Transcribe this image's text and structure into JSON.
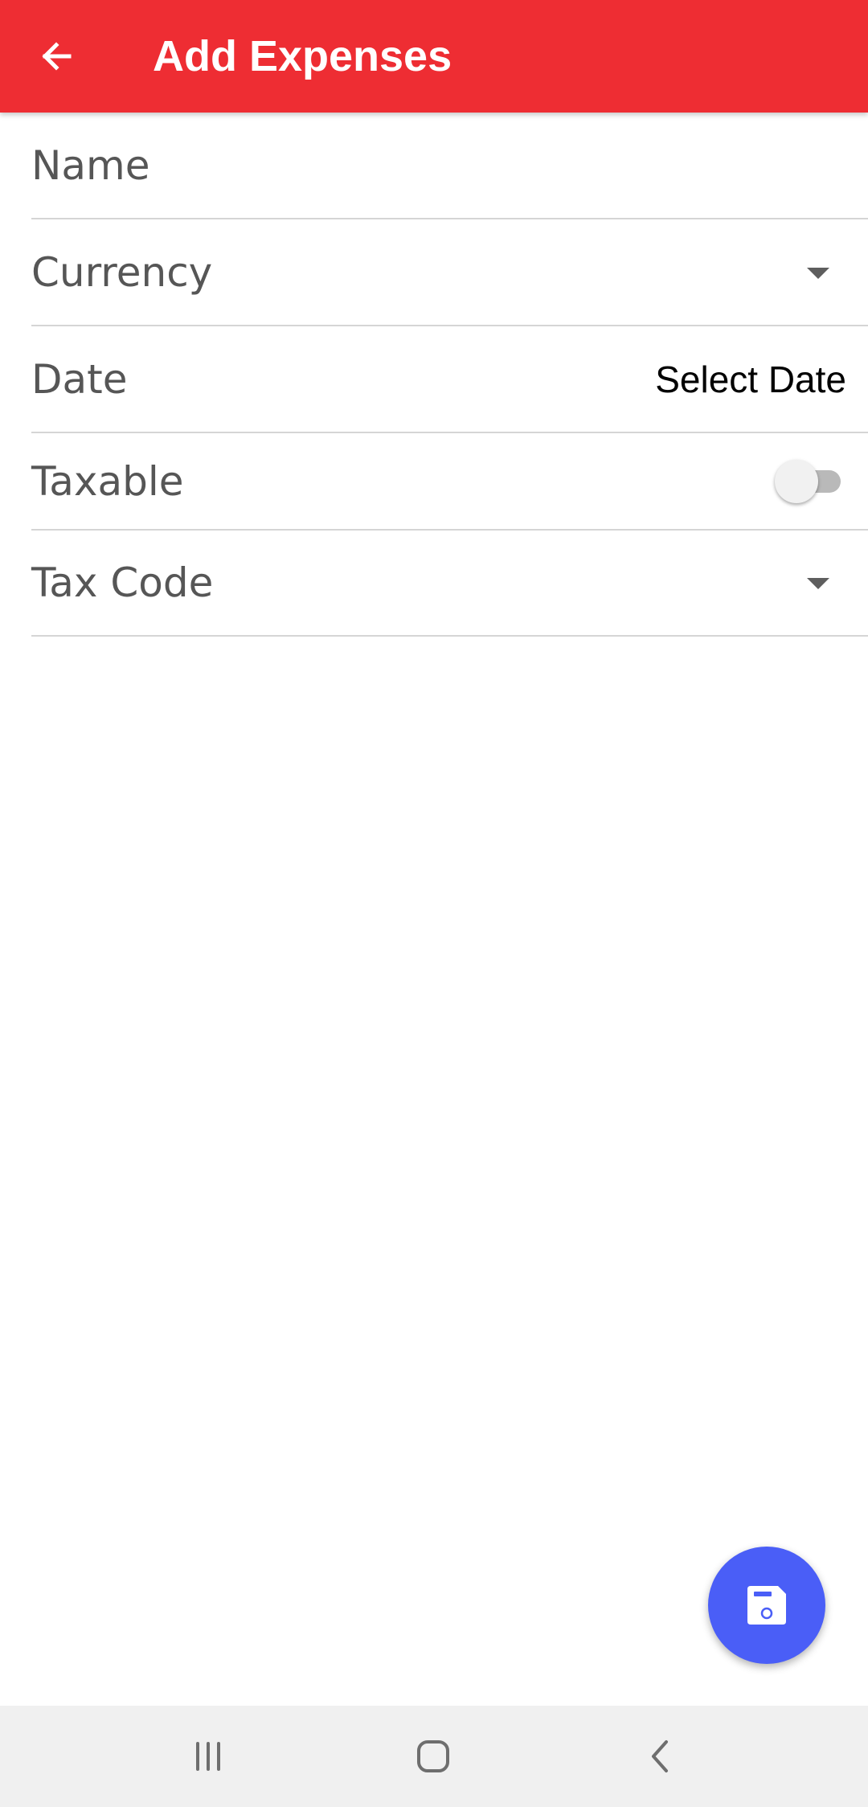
{
  "app_bar": {
    "title": "Add Expenses",
    "back_icon": "arrow-left-icon",
    "background_color": "#ee2d33"
  },
  "form": {
    "name_label": "Name",
    "currency_label": "Currency",
    "date_label": "Date",
    "date_value": "Select Date",
    "taxable_label": "Taxable",
    "taxable_on": false,
    "tax_code_label": "Tax Code"
  },
  "fab": {
    "icon": "save-icon",
    "color": "#4a5ef7"
  },
  "nav_bar": {
    "recents_icon": "recents-icon",
    "home_icon": "home-icon",
    "back_icon": "back-chevron-icon"
  }
}
